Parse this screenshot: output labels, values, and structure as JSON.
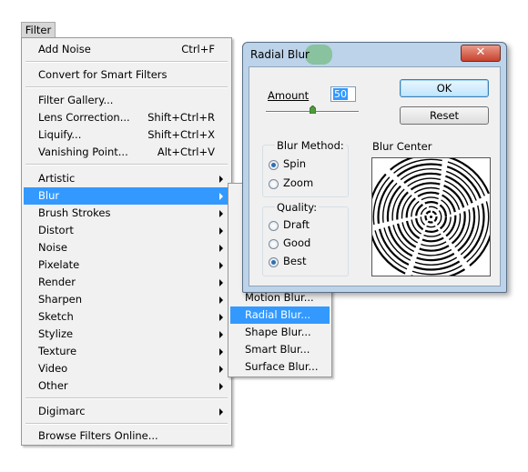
{
  "menubar": {
    "filter_label": "Filter"
  },
  "menu": {
    "items": [
      {
        "label": "Add Noise",
        "shortcut": "Ctrl+F"
      },
      {
        "label": "Convert for Smart Filters",
        "shortcut": ""
      },
      {
        "label": "Filter Gallery...",
        "shortcut": ""
      },
      {
        "label": "Lens Correction...",
        "shortcut": "Shift+Ctrl+R"
      },
      {
        "label": "Liquify...",
        "shortcut": "Shift+Ctrl+X"
      },
      {
        "label": "Vanishing Point...",
        "shortcut": "Alt+Ctrl+V"
      },
      {
        "label": "Artistic",
        "shortcut": ""
      },
      {
        "label": "Blur",
        "shortcut": ""
      },
      {
        "label": "Brush Strokes",
        "shortcut": ""
      },
      {
        "label": "Distort",
        "shortcut": ""
      },
      {
        "label": "Noise",
        "shortcut": ""
      },
      {
        "label": "Pixelate",
        "shortcut": ""
      },
      {
        "label": "Render",
        "shortcut": ""
      },
      {
        "label": "Sharpen",
        "shortcut": ""
      },
      {
        "label": "Sketch",
        "shortcut": ""
      },
      {
        "label": "Stylize",
        "shortcut": ""
      },
      {
        "label": "Texture",
        "shortcut": ""
      },
      {
        "label": "Video",
        "shortcut": ""
      },
      {
        "label": "Other",
        "shortcut": ""
      },
      {
        "label": "Digimarc",
        "shortcut": ""
      },
      {
        "label": "Browse Filters Online...",
        "shortcut": ""
      }
    ]
  },
  "blur_submenu": {
    "items": [
      {
        "label": "Motion Blur..."
      },
      {
        "label": "Radial Blur..."
      },
      {
        "label": "Shape Blur..."
      },
      {
        "label": "Smart Blur..."
      },
      {
        "label": "Surface Blur..."
      }
    ]
  },
  "dialog": {
    "title": "Radial Blur",
    "close_label": "✕",
    "amount_label": "Amount",
    "amount_value": "50",
    "amount_max": 100,
    "ok_label": "OK",
    "reset_label": "Reset",
    "blur_method_title": "Blur Method:",
    "blur_method_options": [
      "Spin",
      "Zoom"
    ],
    "blur_method_selected": "Spin",
    "quality_title": "Quality:",
    "quality_options": [
      "Draft",
      "Good",
      "Best"
    ],
    "quality_selected": "Best",
    "blur_center_label": "Blur Center"
  },
  "colors": {
    "highlight": "#3399ff",
    "close_button": "#c7422d",
    "dialog_frame": "#bcd3ea"
  }
}
